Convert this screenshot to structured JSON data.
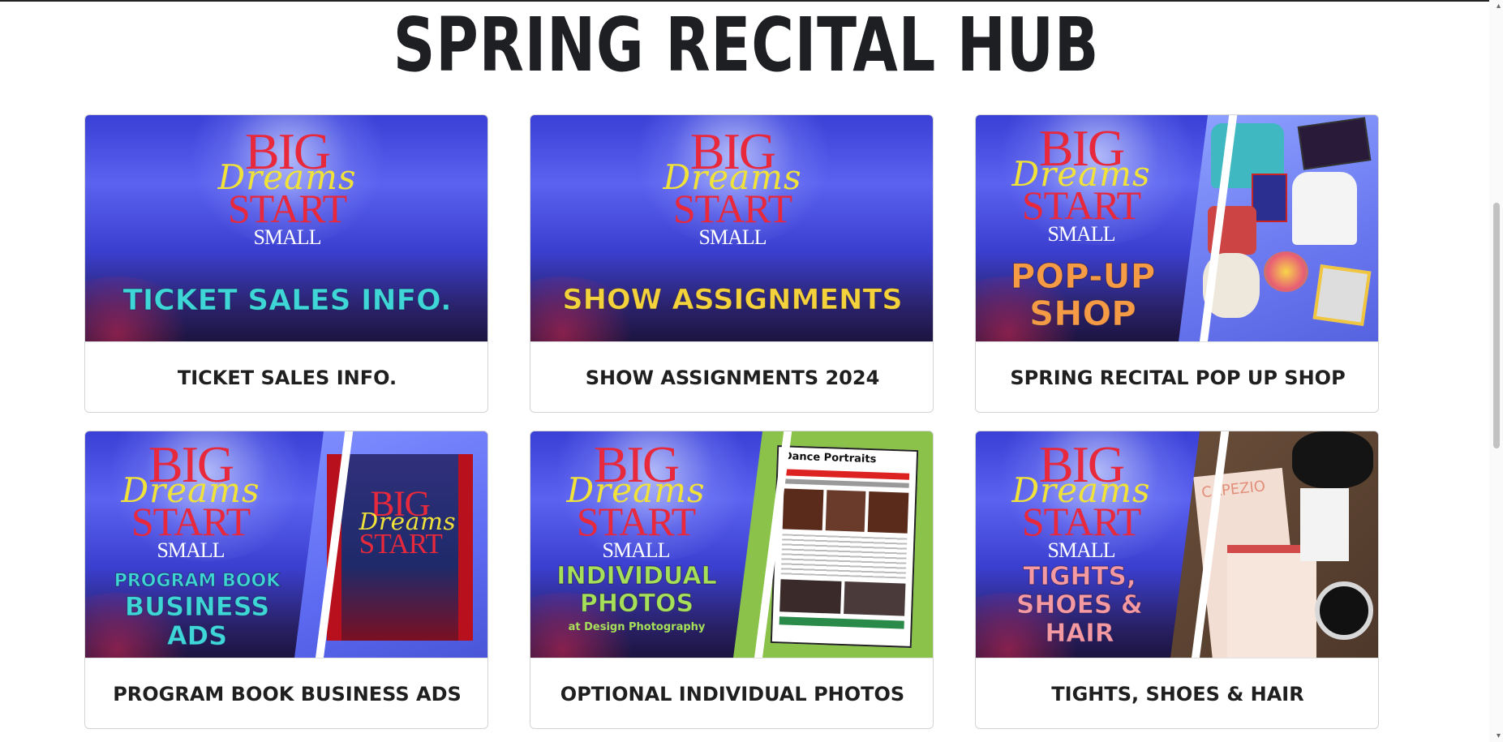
{
  "page": {
    "title": "SPRING RECITAL HUB"
  },
  "cards": [
    {
      "caption": "TICKET SALES INFO.",
      "banner": "TICKET SALES INFO.",
      "logo": {
        "big": "BIG",
        "dreams": "Dreams",
        "start": "START",
        "small": "SMALL"
      }
    },
    {
      "caption": "SHOW ASSIGNMENTS 2024",
      "banner": "SHOW ASSIGNMENTS",
      "logo": {
        "big": "BIG",
        "dreams": "Dreams",
        "start": "START",
        "small": "SMALL"
      }
    },
    {
      "caption": "SPRING RECITAL POP UP SHOP",
      "banner_line1": "POP-UP",
      "banner_line2": "SHOP",
      "logo": {
        "big": "BIG",
        "dreams": "Dreams",
        "start": "START",
        "small": "SMALL"
      }
    },
    {
      "caption": "PROGRAM BOOK BUSINESS ADS",
      "banner_line1": "PROGRAM BOOK",
      "banner_line2": "BUSINESS",
      "banner_line3": "ADS",
      "logo": {
        "big": "BIG",
        "dreams": "Dreams",
        "start": "START",
        "small": "SMALL"
      }
    },
    {
      "caption": "OPTIONAL INDIVIDUAL PHOTOS",
      "banner_line1": "INDIVIDUAL",
      "banner_line2": "PHOTOS",
      "banner_line3": "at Design Photography",
      "flyer_title": "Dance Portraits",
      "logo": {
        "big": "BIG",
        "dreams": "Dreams",
        "start": "START",
        "small": "SMALL"
      }
    },
    {
      "caption": "TIGHTS, SHOES & HAIR",
      "banner_line1": "TIGHTS,",
      "banner_line2": "SHOES &",
      "banner_line3": "HAIR",
      "tights_brand": "CAPEZIO",
      "logo": {
        "big": "BIG",
        "dreams": "Dreams",
        "start": "START",
        "small": "SMALL"
      }
    }
  ],
  "colors": {
    "banner_cyan": "#3ed6d6",
    "banner_yellow": "#f4d23c",
    "banner_orange": "#f59a45",
    "banner_green": "#a6e05a",
    "banner_pink": "#f59aa2",
    "flyer_green": "#8bc34a"
  }
}
